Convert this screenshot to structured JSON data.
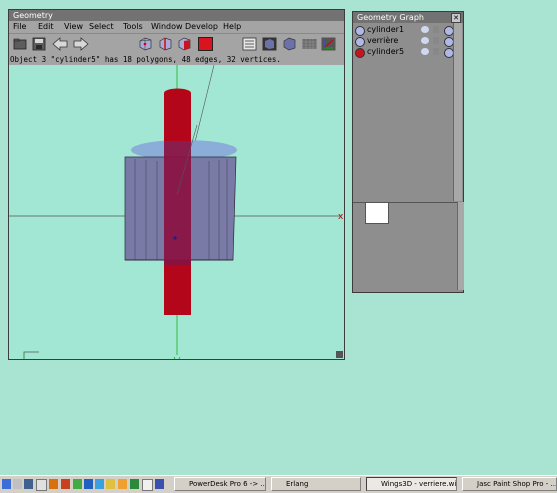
{
  "geometry_window": {
    "title": "Geometry",
    "menus": [
      "File",
      "Edit",
      "View",
      "Select",
      "Tools",
      "Window",
      "Develop",
      "Help"
    ],
    "status": "Object 3 \"cylinder5\" has 18 polygons, 48 edges, 32 vertices.",
    "toolbar_icons": [
      "open-file-icon",
      "save-icon",
      "undo-arrow-icon",
      "redo-arrow-icon",
      "vertex-select-icon",
      "edge-select-icon",
      "face-select-icon",
      "object-select-icon",
      "wireframe-view-icon",
      "smooth-view-icon",
      "flat-view-icon",
      "groundplane-icon",
      "axes-icon"
    ],
    "axis_x_label": "x",
    "colors": {
      "viewport_bg": "#a2e6d4",
      "cylinder": "#b5051a",
      "disc": "#7a7aa6"
    }
  },
  "graph_window": {
    "title": "Geometry Graph",
    "items": [
      {
        "label": "cylinder1",
        "icon": "object-icon"
      },
      {
        "label": "verrière",
        "icon": "object-icon"
      },
      {
        "label": "cylinder5",
        "icon": "selected-object-icon"
      }
    ]
  },
  "taskbar": {
    "tasks": [
      {
        "label": "PowerDesk Pro 6 -> ...",
        "active": false
      },
      {
        "label": "Erlang",
        "active": false
      },
      {
        "label": "Wings3D - verriere.wi...",
        "active": true
      },
      {
        "label": "Jasc Paint Shop Pro - ...",
        "active": false
      }
    ]
  }
}
